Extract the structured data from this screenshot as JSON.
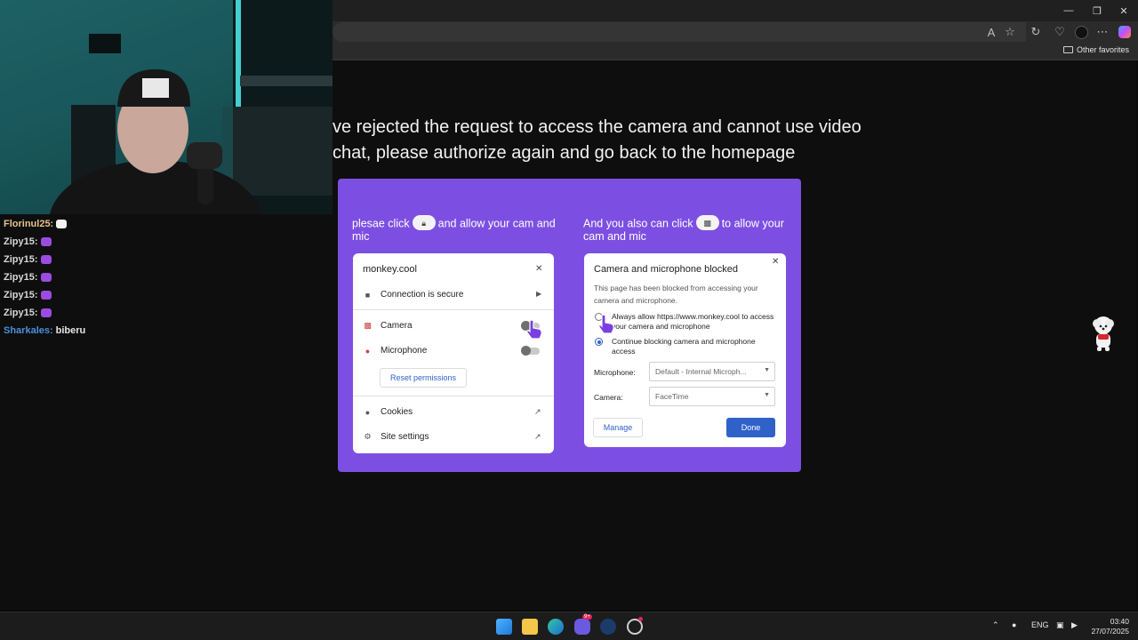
{
  "browser": {
    "favorites_label": "Other favorites"
  },
  "page": {
    "message_line1": "ve rejected the request to access the camera and cannot use video",
    "message_line2": "chat, please authorize again and go back to the homepage",
    "instr_left_pre": "plesae click",
    "instr_left_post": "and allow your cam and mic",
    "instr_right_pre": "And you also can click",
    "instr_right_post": "to allow your cam and mic"
  },
  "site_panel": {
    "domain": "monkey.cool",
    "connection": "Connection is secure",
    "camera": "Camera",
    "microphone": "Microphone",
    "reset": "Reset permissions",
    "cookies": "Cookies",
    "site_settings": "Site settings"
  },
  "blocked_panel": {
    "title": "Camera and microphone blocked",
    "description": "This page has been blocked from accessing your camera and microphone.",
    "option_allow": "Always allow https://www.monkey.cool to access your camera and microphone",
    "option_block": "Continue blocking camera and microphone access",
    "microphone_label": "Microphone:",
    "microphone_value": "Default - Internal Microph...",
    "camera_label": "Camera:",
    "camera_value": "FaceTime",
    "manage": "Manage",
    "done": "Done"
  },
  "chat": [
    {
      "user": "Florinul25:",
      "color": "#e8c28a",
      "emote_color": "#f2f2f2"
    },
    {
      "user": "Zipy15:",
      "color": "#d8d8d8",
      "emote_color": "#9b4ce0"
    },
    {
      "user": "Zipy15:",
      "color": "#d8d8d8",
      "emote_color": "#9b4ce0"
    },
    {
      "user": "Zipy15:",
      "color": "#d8d8d8",
      "emote_color": "#9b4ce0"
    },
    {
      "user": "Zipy15:",
      "color": "#d8d8d8",
      "emote_color": "#9b4ce0"
    },
    {
      "user": "Zipy15:",
      "color": "#d8d8d8",
      "emote_color": "#9b4ce0"
    },
    {
      "user": "Sharkales:",
      "color": "#4a90d9",
      "message": "biberu",
      "emote_color": "#3aa85b"
    }
  ],
  "taskbar": {
    "language": "ENG",
    "time": "03:40",
    "date": "27/07/2025",
    "badge": "9+"
  },
  "colors": {
    "card_purple": "#7c4fe2",
    "button_blue": "#2f62c9"
  }
}
